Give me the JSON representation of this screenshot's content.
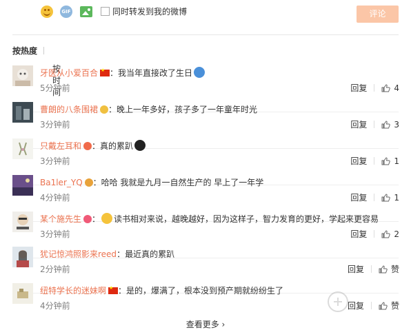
{
  "toolbar": {
    "forward_label": "同时转发到我的微博",
    "submit_label": "评论",
    "gif_label": "GIF"
  },
  "sort": {
    "hot": "按热度",
    "time": "按时间"
  },
  "comments": [
    {
      "user": "牙医从小爱百合",
      "text": "：我当年直接改了生日",
      "time": "5分钟前",
      "reply": "回复",
      "likes": "4"
    },
    {
      "user": "曹朗的八条围裙",
      "text": "：晚上一年多好，孩子多了一年童年时光",
      "time": "3分钟前",
      "reply": "回复",
      "likes": "3"
    },
    {
      "user": "只戴左耳和",
      "text": "：真的累趴",
      "time": "3分钟前",
      "reply": "回复",
      "likes": "1"
    },
    {
      "user": "Ba1ler_YQ",
      "text": "：哈哈  我就是九月一自然生产的  早上了一年学",
      "time": "4分钟前",
      "reply": "回复",
      "likes": "1"
    },
    {
      "user": "某个施先生",
      "text": "读书相对来说，越晚越好，因为这样子，智力发育的更好，学起来更容易",
      "time": "3分钟前",
      "reply": "回复",
      "likes": "2"
    },
    {
      "user": "犹记惊鸿照影来reed",
      "text": "：最近真的累趴",
      "time": "2分钟前",
      "reply": "回复",
      "likes": "赞"
    },
    {
      "user": "纽特学长的迷妹啊",
      "text": "：是的，爆满了，根本没到预产期就纷纷生了",
      "time": "4分钟前",
      "reply": "回复",
      "likes": "赞"
    }
  ],
  "more": "查看更多 ›",
  "colors": {
    "username": "#eb7350",
    "submit_bg": "#fbc6a7",
    "time": "#808080"
  }
}
